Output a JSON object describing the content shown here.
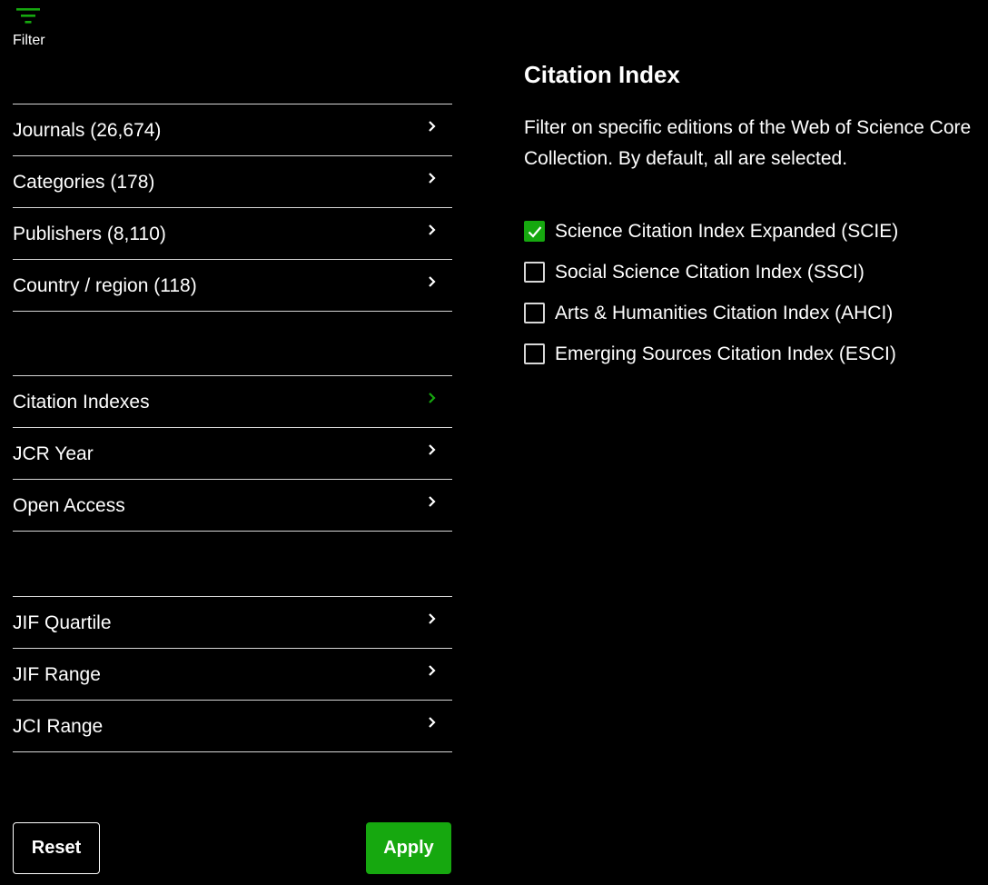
{
  "filter": {
    "label": "Filter",
    "icon": "filter-lines-icon",
    "accent": "#16a80f"
  },
  "groups": [
    {
      "items": [
        {
          "label": "Journals (26,674)",
          "active": false
        },
        {
          "label": "Categories (178)",
          "active": false
        },
        {
          "label": "Publishers (8,110)",
          "active": false
        },
        {
          "label": "Country / region (118)",
          "active": false
        }
      ]
    },
    {
      "items": [
        {
          "label": "Citation Indexes",
          "active": true
        },
        {
          "label": "JCR Year",
          "active": false
        },
        {
          "label": "Open Access",
          "active": false
        }
      ]
    },
    {
      "items": [
        {
          "label": "JIF Quartile",
          "active": false
        },
        {
          "label": "JIF Range",
          "active": false
        },
        {
          "label": "JCI Range",
          "active": false
        }
      ]
    }
  ],
  "buttons": {
    "reset": "Reset",
    "apply": "Apply"
  },
  "panel": {
    "title": "Citation Index",
    "description": "Filter on specific editions of the Web of Science Core Collection. By default, all are selected.",
    "options": [
      {
        "label": "Science Citation Index Expanded (SCIE)",
        "checked": true
      },
      {
        "label": "Social Science Citation Index (SSCI)",
        "checked": false
      },
      {
        "label": "Arts & Humanities Citation Index (AHCI)",
        "checked": false
      },
      {
        "label": "Emerging Sources Citation Index (ESCI)",
        "checked": false
      }
    ]
  },
  "colors": {
    "accent": "#16a80f",
    "divider": "#d6d6d6",
    "background": "#000000",
    "text": "#ffffff"
  }
}
